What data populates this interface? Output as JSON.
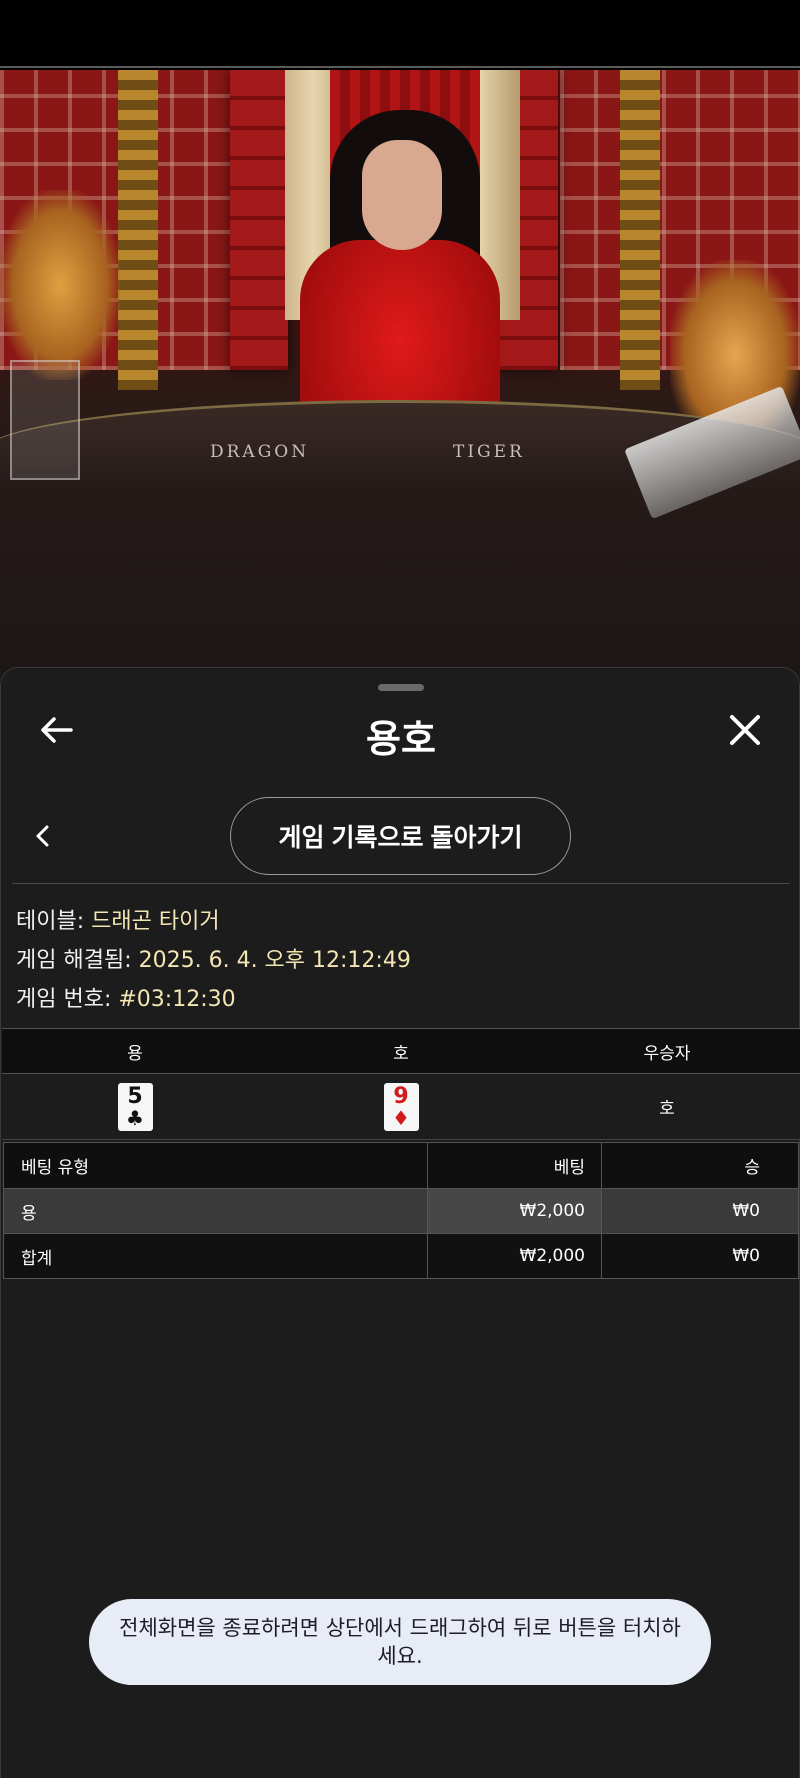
{
  "video": {
    "table_labels": {
      "dragon": "DRAGON",
      "tiger": "TIGER"
    }
  },
  "header": {
    "title": "용호",
    "back_icon": "arrow-left-icon",
    "close_icon": "close-icon"
  },
  "nav": {
    "prev_icon": "chevron-left-icon",
    "history_button": "게임 기록으로 돌아가기"
  },
  "info": {
    "table_label": "테이블: ",
    "table_value": "드래곤 타이거",
    "resolved_label": "게임 해결됨: ",
    "resolved_value": "2025. 6. 4. 오후 12:12:49",
    "game_no_label": "게임 번호: ",
    "game_no_value": "#03:12:30"
  },
  "result": {
    "headers": [
      "용",
      "호",
      "우승자"
    ],
    "dragon_card": {
      "rank": "5",
      "suit": "♣",
      "color": "#111111"
    },
    "tiger_card": {
      "rank": "9",
      "suit": "♦",
      "color": "#d21a1a"
    },
    "winner": "호"
  },
  "bets": {
    "headers": [
      "베팅 유형",
      "베팅",
      "승"
    ],
    "rows": [
      {
        "type": "용",
        "bet": "₩2,000",
        "win": "₩0"
      }
    ],
    "total": {
      "type": "합계",
      "bet": "₩2,000",
      "win": "₩0"
    }
  },
  "toast": {
    "message": "전체화면을 종료하려면 상단에서 드래그하여 뒤로 버튼을 터치하세요."
  },
  "colors": {
    "panel_bg": "#1c1c1c",
    "info_value": "#f3e6b3",
    "toast_bg": "#e8ecf7"
  }
}
